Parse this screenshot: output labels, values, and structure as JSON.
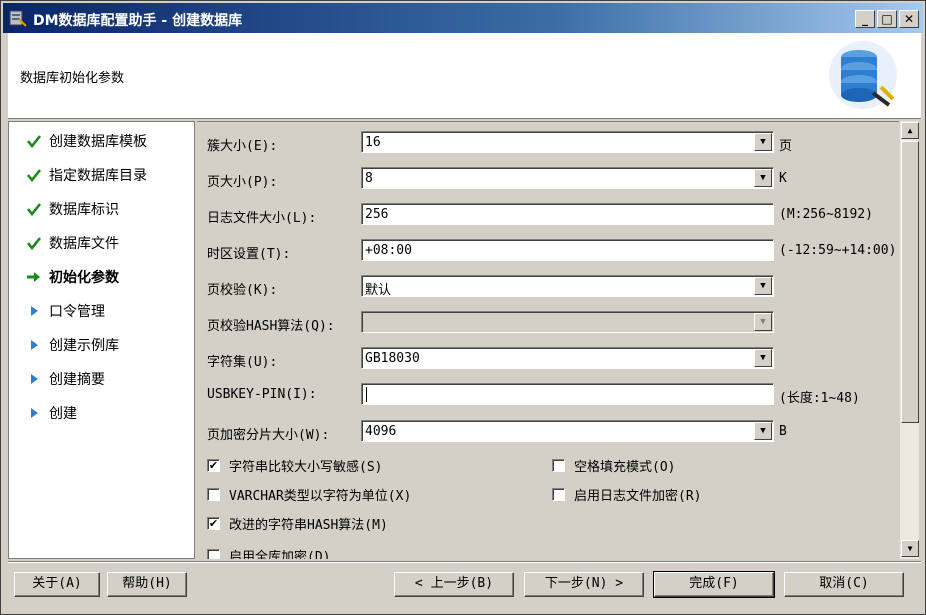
{
  "window": {
    "title": "DM数据库配置助手 - 创建数据库",
    "minimize_glyph": "_",
    "maximize_glyph": "□",
    "close_glyph": "✕"
  },
  "header": {
    "subtitle": "数据库初始化参数",
    "logo_icon": "database-config-icon"
  },
  "nav": {
    "items": [
      {
        "label": "创建数据库模板",
        "state": "done",
        "icon": "checkmark-icon"
      },
      {
        "label": "指定数据库目录",
        "state": "done",
        "icon": "checkmark-icon"
      },
      {
        "label": "数据库标识",
        "state": "done",
        "icon": "checkmark-icon"
      },
      {
        "label": "数据库文件",
        "state": "done",
        "icon": "checkmark-icon"
      },
      {
        "label": "初始化参数",
        "state": "current",
        "icon": "arrow-right-icon"
      },
      {
        "label": "口令管理",
        "state": "pending",
        "icon": "triangle-right-icon"
      },
      {
        "label": "创建示例库",
        "state": "pending",
        "icon": "triangle-right-icon"
      },
      {
        "label": "创建摘要",
        "state": "pending",
        "icon": "triangle-right-icon"
      },
      {
        "label": "创建",
        "state": "pending",
        "icon": "triangle-right-icon"
      }
    ]
  },
  "form": {
    "extent_size": {
      "label": "簇大小(E):",
      "value": "16",
      "suffix": "页"
    },
    "page_size": {
      "label": "页大小(P):",
      "value": "8",
      "suffix": "K"
    },
    "log_file_size": {
      "label": "日志文件大小(L):",
      "value": "256",
      "suffix": "(M:256~8192)"
    },
    "time_zone": {
      "label": "时区设置(T):",
      "value": "+08:00",
      "suffix": "(-12:59~+14:00)"
    },
    "page_check": {
      "label": "页校验(K):",
      "value": "默认"
    },
    "page_check_hash": {
      "label": "页校验HASH算法(Q):",
      "value": ""
    },
    "charset": {
      "label": "字符集(U):",
      "value": "GB18030"
    },
    "usbkey_pin": {
      "label": "USBKEY-PIN(I):",
      "value": "",
      "suffix": "(长度:1~48)"
    },
    "encrypt_slice": {
      "label": "页加密分片大小(W):",
      "value": "4096",
      "suffix": "B"
    },
    "checkboxes": [
      {
        "label": "字符串比较大小写敏感(S)",
        "checked": true
      },
      {
        "label": "空格填充模式(O)",
        "checked": false
      },
      {
        "label": "VARCHAR类型以字符为单位(X)",
        "checked": false
      },
      {
        "label": "启用日志文件加密(R)",
        "checked": false
      },
      {
        "label": "改进的字符串HASH算法(M)",
        "checked": true
      },
      {
        "label": "启用全库加密(D)",
        "checked": false
      }
    ],
    "dropdown_glyph": "▼",
    "check_glyph": "✔"
  },
  "buttons": {
    "about": "关于(A)",
    "help": "帮助(H)",
    "prev": "< 上一步(B)",
    "next": "下一步(N) >",
    "finish": "完成(F)",
    "cancel": "取消(C)"
  },
  "scrollbar": {
    "up_glyph": "▲",
    "down_glyph": "▼"
  }
}
